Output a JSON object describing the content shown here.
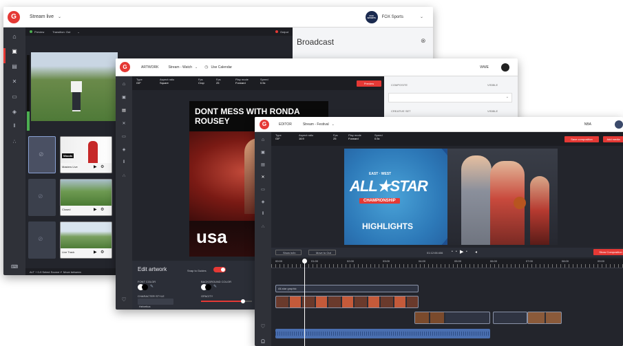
{
  "colors": {
    "accent": "#e53935",
    "rail": "#2f3138",
    "panel": "#23252c",
    "clip_blue": "#4a6fb0"
  },
  "win1": {
    "logo": "G",
    "title": "Stream live",
    "channel_logo": "FOX SPORTS",
    "channel_name": "FOX Sports",
    "preview_label": "Preview",
    "transition_label": "Transition: Out",
    "output_label": "Output",
    "panel_title": "Broadcast",
    "tiles": [
      {
        "label": "Woods",
        "caption": "Masters Live"
      },
      {
        "label": "",
        "caption": "Closed"
      },
      {
        "label": "",
        "caption": "Live Track"
      }
    ],
    "footer": "ALT + 0-9 Select Source   ↵ Move between"
  },
  "win2": {
    "logo": "G",
    "tab1": "ARTWORK",
    "tab2": "Stream - Watch",
    "calendar": "Use Calendar",
    "user": "WWE",
    "fields": [
      {
        "label": "Type",
        "value": "GIF"
      },
      {
        "label": "Aspect ratio",
        "value": "Square"
      },
      {
        "label": "Fps",
        "value": "Crop"
      },
      {
        "label": "Fps",
        "value": "25"
      },
      {
        "label": "Play mode",
        "value": "Forward"
      },
      {
        "label": "Speed",
        "value": "0.5x"
      }
    ],
    "preview_btn": "Preview",
    "side_headers": [
      "COMPOSITE",
      "VISIBLE",
      "CREATIVE SET",
      "VISIBLE"
    ],
    "art_headline": "DONT MESS WITH RONDA ROUSEY",
    "art_brand": "usa",
    "edit_title": "Edit artwork",
    "snap_label": "Snap to Guides",
    "font_color": "FONT COLOR",
    "bg_color": "BACKGROUND COLOR",
    "opacity_label": "OPACITY",
    "character_label": "CHARACTER STYLE",
    "character_value": "Helvetica"
  },
  "win3": {
    "logo": "G",
    "tab1": "EDITOR",
    "tab2": "Stream - Festival",
    "user": "NBA",
    "fields": [
      {
        "label": "Type",
        "value": "GIF"
      },
      {
        "label": "Aspect ratio",
        "value": "16:9"
      },
      {
        "label": "Fps",
        "value": "25"
      },
      {
        "label": "Play mode",
        "value": "Forward"
      },
      {
        "label": "Speed",
        "value": "0.5x"
      }
    ],
    "save_btn": "Save composition",
    "add_btn": "Add media",
    "art_east_west": "EAST · WEST",
    "art_title": "ALL★STAR",
    "art_subtitle": "CHAMPIONSHIP",
    "art_highlights": "HIGHLIGHTS",
    "show_in": "Show in/in",
    "move_to_out": "Move to Out",
    "timecode": "01:12:06:406",
    "show_composition": "Show Composition",
    "ruler": [
      "00:00",
      "01:00",
      "02:00",
      "03:00",
      "04:00",
      "05:00",
      "06:00",
      "07:00",
      "08:00",
      "09:00"
    ],
    "overlay_clip": "All-star graphic"
  }
}
